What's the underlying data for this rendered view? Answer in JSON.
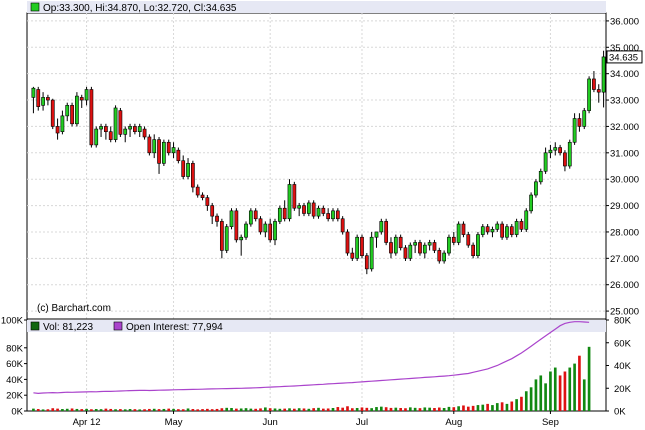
{
  "chart_data": [
    {
      "type": "candlestick",
      "header": {
        "open_label": "Op:",
        "open": "33.300",
        "high_label": "Hi:",
        "high": "34.870",
        "low_label": "Lo:",
        "low": "32.720",
        "close_label": "Cl:",
        "close": "34.635",
        "text": "Op:33.300, Hi:34.870, Lo:32.720, Cl:34.635"
      },
      "last_price_label": "34.635",
      "watermark": "(c) Barchart.com",
      "y_ticks": [
        "25.000",
        "26.000",
        "27.000",
        "28.000",
        "29.000",
        "30.000",
        "31.000",
        "32.000",
        "33.000",
        "34.000",
        "35.000",
        "36.000"
      ],
      "ylim": [
        24.7,
        36.3
      ],
      "x_ticks": [
        "Apr 12",
        "May",
        "Jun",
        "Jul",
        "Aug",
        "Sep"
      ],
      "x_tick_index": [
        11,
        29,
        49,
        68,
        87,
        107
      ],
      "colors": {
        "up": "#22cc22",
        "down": "#dd1111"
      },
      "ohlc": [
        [
          33.1,
          33.5,
          32.5,
          33.45
        ],
        [
          33.4,
          33.5,
          32.6,
          32.75
        ],
        [
          32.8,
          33.3,
          32.6,
          33.1
        ],
        [
          33.1,
          33.2,
          32.8,
          33.0
        ],
        [
          33.0,
          33.05,
          31.9,
          32.0
        ],
        [
          32.0,
          32.3,
          31.5,
          31.75
        ],
        [
          31.8,
          32.6,
          31.7,
          32.4
        ],
        [
          32.4,
          32.9,
          32.2,
          32.8
        ],
        [
          32.8,
          32.9,
          32.0,
          32.1
        ],
        [
          32.1,
          33.3,
          32.0,
          33.15
        ],
        [
          33.1,
          33.2,
          32.7,
          33.0
        ],
        [
          33.0,
          33.5,
          32.8,
          33.4
        ],
        [
          33.4,
          33.5,
          31.2,
          31.3
        ],
        [
          31.3,
          32.0,
          31.2,
          31.9
        ],
        [
          31.9,
          32.1,
          31.6,
          32.0
        ],
        [
          32.0,
          32.1,
          31.5,
          31.8
        ],
        [
          31.8,
          32.0,
          31.4,
          31.5
        ],
        [
          31.5,
          32.8,
          31.4,
          32.7
        ],
        [
          32.6,
          32.7,
          31.6,
          31.7
        ],
        [
          31.7,
          32.0,
          31.4,
          31.9
        ],
        [
          31.9,
          32.1,
          31.6,
          32.0
        ],
        [
          32.0,
          32.1,
          31.7,
          31.8
        ],
        [
          31.8,
          32.1,
          31.6,
          32.0
        ],
        [
          31.9,
          32.0,
          31.5,
          31.6
        ],
        [
          31.6,
          31.7,
          30.9,
          31.0
        ],
        [
          31.0,
          31.7,
          30.8,
          31.5
        ],
        [
          31.5,
          31.6,
          30.2,
          30.6
        ],
        [
          30.6,
          31.5,
          30.5,
          31.4
        ],
        [
          31.4,
          31.5,
          30.9,
          31.0
        ],
        [
          31.0,
          31.4,
          30.8,
          31.2
        ],
        [
          31.1,
          31.2,
          30.6,
          30.7
        ],
        [
          30.7,
          30.9,
          30.0,
          30.1
        ],
        [
          30.1,
          30.8,
          30.0,
          30.6
        ],
        [
          30.6,
          30.7,
          29.5,
          29.7
        ],
        [
          29.7,
          29.8,
          29.3,
          29.4
        ],
        [
          29.4,
          29.5,
          29.2,
          29.3
        ],
        [
          29.3,
          29.4,
          28.8,
          29.0
        ],
        [
          29.0,
          29.1,
          28.3,
          28.6
        ],
        [
          28.6,
          28.7,
          28.2,
          28.4
        ],
        [
          28.4,
          28.5,
          27.0,
          27.3
        ],
        [
          27.3,
          28.3,
          27.2,
          28.2
        ],
        [
          28.2,
          28.9,
          28.1,
          28.8
        ],
        [
          28.8,
          28.9,
          27.6,
          27.7
        ],
        [
          27.7,
          27.9,
          27.1,
          27.8
        ],
        [
          27.8,
          28.4,
          27.7,
          28.3
        ],
        [
          28.3,
          28.9,
          28.2,
          28.8
        ],
        [
          28.8,
          28.9,
          28.4,
          28.5
        ],
        [
          28.5,
          28.6,
          27.9,
          28.0
        ],
        [
          28.0,
          28.4,
          27.8,
          28.3
        ],
        [
          28.3,
          28.5,
          27.6,
          27.7
        ],
        [
          27.7,
          28.5,
          27.5,
          28.4
        ],
        [
          28.4,
          29.0,
          28.3,
          28.9
        ],
        [
          28.9,
          29.2,
          28.4,
          28.5
        ],
        [
          28.5,
          30.0,
          28.4,
          29.8
        ],
        [
          29.8,
          29.9,
          28.8,
          28.9
        ],
        [
          28.9,
          29.1,
          28.6,
          29.0
        ],
        [
          29.0,
          29.1,
          28.6,
          28.7
        ],
        [
          28.7,
          29.2,
          28.6,
          29.1
        ],
        [
          29.1,
          29.2,
          28.5,
          28.6
        ],
        [
          28.6,
          29.0,
          28.5,
          28.9
        ],
        [
          28.9,
          29.0,
          28.6,
          28.7
        ],
        [
          28.7,
          28.9,
          28.4,
          28.5
        ],
        [
          28.5,
          28.9,
          28.4,
          28.8
        ],
        [
          28.8,
          28.9,
          28.4,
          28.5
        ],
        [
          28.5,
          28.6,
          27.9,
          28.0
        ],
        [
          28.0,
          28.1,
          27.1,
          27.2
        ],
        [
          27.2,
          27.4,
          26.9,
          27.0
        ],
        [
          27.0,
          27.9,
          26.9,
          27.8
        ],
        [
          27.8,
          27.9,
          27.0,
          27.1
        ],
        [
          27.1,
          27.2,
          26.4,
          26.6
        ],
        [
          26.6,
          28.0,
          26.5,
          27.8
        ],
        [
          27.8,
          28.0,
          27.4,
          28.0
        ],
        [
          28.0,
          28.5,
          27.9,
          28.4
        ],
        [
          28.4,
          28.5,
          27.5,
          27.6
        ],
        [
          27.6,
          27.8,
          27.0,
          27.2
        ],
        [
          27.2,
          27.9,
          27.1,
          27.8
        ],
        [
          27.8,
          27.9,
          27.3,
          27.4
        ],
        [
          27.4,
          27.5,
          26.9,
          27.0
        ],
        [
          27.0,
          27.6,
          26.9,
          27.5
        ],
        [
          27.5,
          27.7,
          27.2,
          27.6
        ],
        [
          27.6,
          27.7,
          27.1,
          27.2
        ],
        [
          27.2,
          27.6,
          27.0,
          27.5
        ],
        [
          27.5,
          27.7,
          27.3,
          27.6
        ],
        [
          27.6,
          27.7,
          27.2,
          27.3
        ],
        [
          27.3,
          27.4,
          26.8,
          26.9
        ],
        [
          26.9,
          27.3,
          26.8,
          27.2
        ],
        [
          27.2,
          27.9,
          27.1,
          27.8
        ],
        [
          27.8,
          28.0,
          27.5,
          27.6
        ],
        [
          27.6,
          28.4,
          27.5,
          28.3
        ],
        [
          28.3,
          28.4,
          27.8,
          27.9
        ],
        [
          27.9,
          28.0,
          27.4,
          27.5
        ],
        [
          27.5,
          27.6,
          27.0,
          27.1
        ],
        [
          27.1,
          28.0,
          27.0,
          27.9
        ],
        [
          27.9,
          28.3,
          27.8,
          28.2
        ],
        [
          28.2,
          28.3,
          27.9,
          28.0
        ],
        [
          28.0,
          28.2,
          27.8,
          28.1
        ],
        [
          28.1,
          28.4,
          28.0,
          28.3
        ],
        [
          28.3,
          28.4,
          27.7,
          27.8
        ],
        [
          27.8,
          28.3,
          27.7,
          28.2
        ],
        [
          28.2,
          28.3,
          27.8,
          27.9
        ],
        [
          27.9,
          28.5,
          27.8,
          28.4
        ],
        [
          28.4,
          28.5,
          28.0,
          28.1
        ],
        [
          28.1,
          28.9,
          28.0,
          28.8
        ],
        [
          28.8,
          29.5,
          28.7,
          29.4
        ],
        [
          29.4,
          30.0,
          29.3,
          29.9
        ],
        [
          29.9,
          30.4,
          29.8,
          30.3
        ],
        [
          30.3,
          31.2,
          30.2,
          31.0
        ],
        [
          31.0,
          31.3,
          30.8,
          31.1
        ],
        [
          31.1,
          31.4,
          30.9,
          31.2
        ],
        [
          31.2,
          31.3,
          30.9,
          31.0
        ],
        [
          31.0,
          31.1,
          30.3,
          30.5
        ],
        [
          30.5,
          31.5,
          30.4,
          31.4
        ],
        [
          31.4,
          32.5,
          31.3,
          32.3
        ],
        [
          32.3,
          32.5,
          31.8,
          32.0
        ],
        [
          32.0,
          32.7,
          31.9,
          32.6
        ],
        [
          32.6,
          33.9,
          32.5,
          33.8
        ],
        [
          33.8,
          34.1,
          33.3,
          33.4
        ],
        [
          33.4,
          33.6,
          32.9,
          33.3
        ],
        [
          33.3,
          34.87,
          32.72,
          34.635
        ]
      ],
      "volume": {
        "label": "Vol: 81,223",
        "value_text": "81,223",
        "y_ticks_left": [
          "0K",
          "20K",
          "40K",
          "60K",
          "80K",
          "100K"
        ],
        "y_ticks_right": [
          "0K",
          "20K",
          "40K",
          "60K",
          "80K"
        ],
        "ylim": [
          0,
          100000
        ],
        "values": [
          3000,
          2500,
          2000,
          2200,
          3500,
          3000,
          2500,
          2800,
          3200,
          2600,
          2400,
          2700,
          2200,
          2500,
          2300,
          3000,
          2600,
          2200,
          2400,
          2100,
          2500,
          2300,
          2000,
          2200,
          2600,
          2800,
          2400,
          2600,
          3000,
          2700,
          2300,
          2200,
          3200,
          2500,
          2100,
          2400,
          2700,
          2300,
          2600,
          3500,
          4000,
          3800,
          3000,
          3200,
          3600,
          3000,
          2800,
          3300,
          4500,
          3500,
          3200,
          2800,
          3000,
          3400,
          2900,
          3500,
          3200,
          2800,
          3600,
          4000,
          3000,
          3200,
          3800,
          5000,
          4200,
          6000,
          3500,
          3800,
          4500,
          4000,
          3600,
          5000,
          5500,
          4800,
          3900,
          4200,
          3800,
          3500,
          4600,
          4000,
          3600,
          4500,
          4200,
          3800,
          4400,
          3800,
          5200,
          4800,
          6000,
          7000,
          5500,
          6500,
          7500,
          8000,
          9000,
          7500,
          10000,
          11000,
          9000,
          12000,
          15000,
          18000,
          25000,
          30000,
          40000,
          45000,
          35000,
          50000,
          55000,
          45000,
          50000,
          55000,
          60000,
          70000,
          40000,
          81223
        ]
      },
      "open_interest": {
        "label": "Open Interest: 77,994",
        "value_text": "77,994",
        "color": "#aa44cc",
        "ylim": [
          0,
          80000
        ],
        "values": [
          16000,
          15500,
          15800,
          16000,
          16200,
          16000,
          16300,
          16500,
          16400,
          16600,
          16700,
          16800,
          17000,
          16900,
          17100,
          17300,
          17200,
          17400,
          17600,
          17800,
          17900,
          18000,
          18100,
          18200,
          18000,
          18100,
          18300,
          18400,
          18500,
          18600,
          18700,
          18800,
          18900,
          19000,
          19100,
          19200,
          19300,
          19400,
          19500,
          19600,
          19700,
          19800,
          19900,
          20000,
          20100,
          20200,
          20400,
          20600,
          20800,
          21000,
          21200,
          21400,
          21600,
          21800,
          22000,
          22200,
          22500,
          22800,
          23000,
          23300,
          23500,
          23800,
          24000,
          24300,
          24500,
          24800,
          25000,
          25300,
          25600,
          25900,
          26200,
          26500,
          26800,
          27100,
          27400,
          27700,
          28000,
          28300,
          28600,
          28900,
          29200,
          29500,
          29800,
          30100,
          30400,
          30700,
          31000,
          31500,
          32000,
          32500,
          33000,
          34000,
          35000,
          36000,
          37000,
          38500,
          40000,
          42000,
          44000,
          46000,
          48500,
          51000,
          54000,
          57000,
          60000,
          63000,
          66000,
          69000,
          72000,
          75000,
          77000,
          78000,
          78500,
          78500,
          78200,
          77994
        ]
      },
      "panel_colors": {
        "volume_legend": "#116611",
        "oi_legend": "#aa44cc"
      }
    }
  ]
}
